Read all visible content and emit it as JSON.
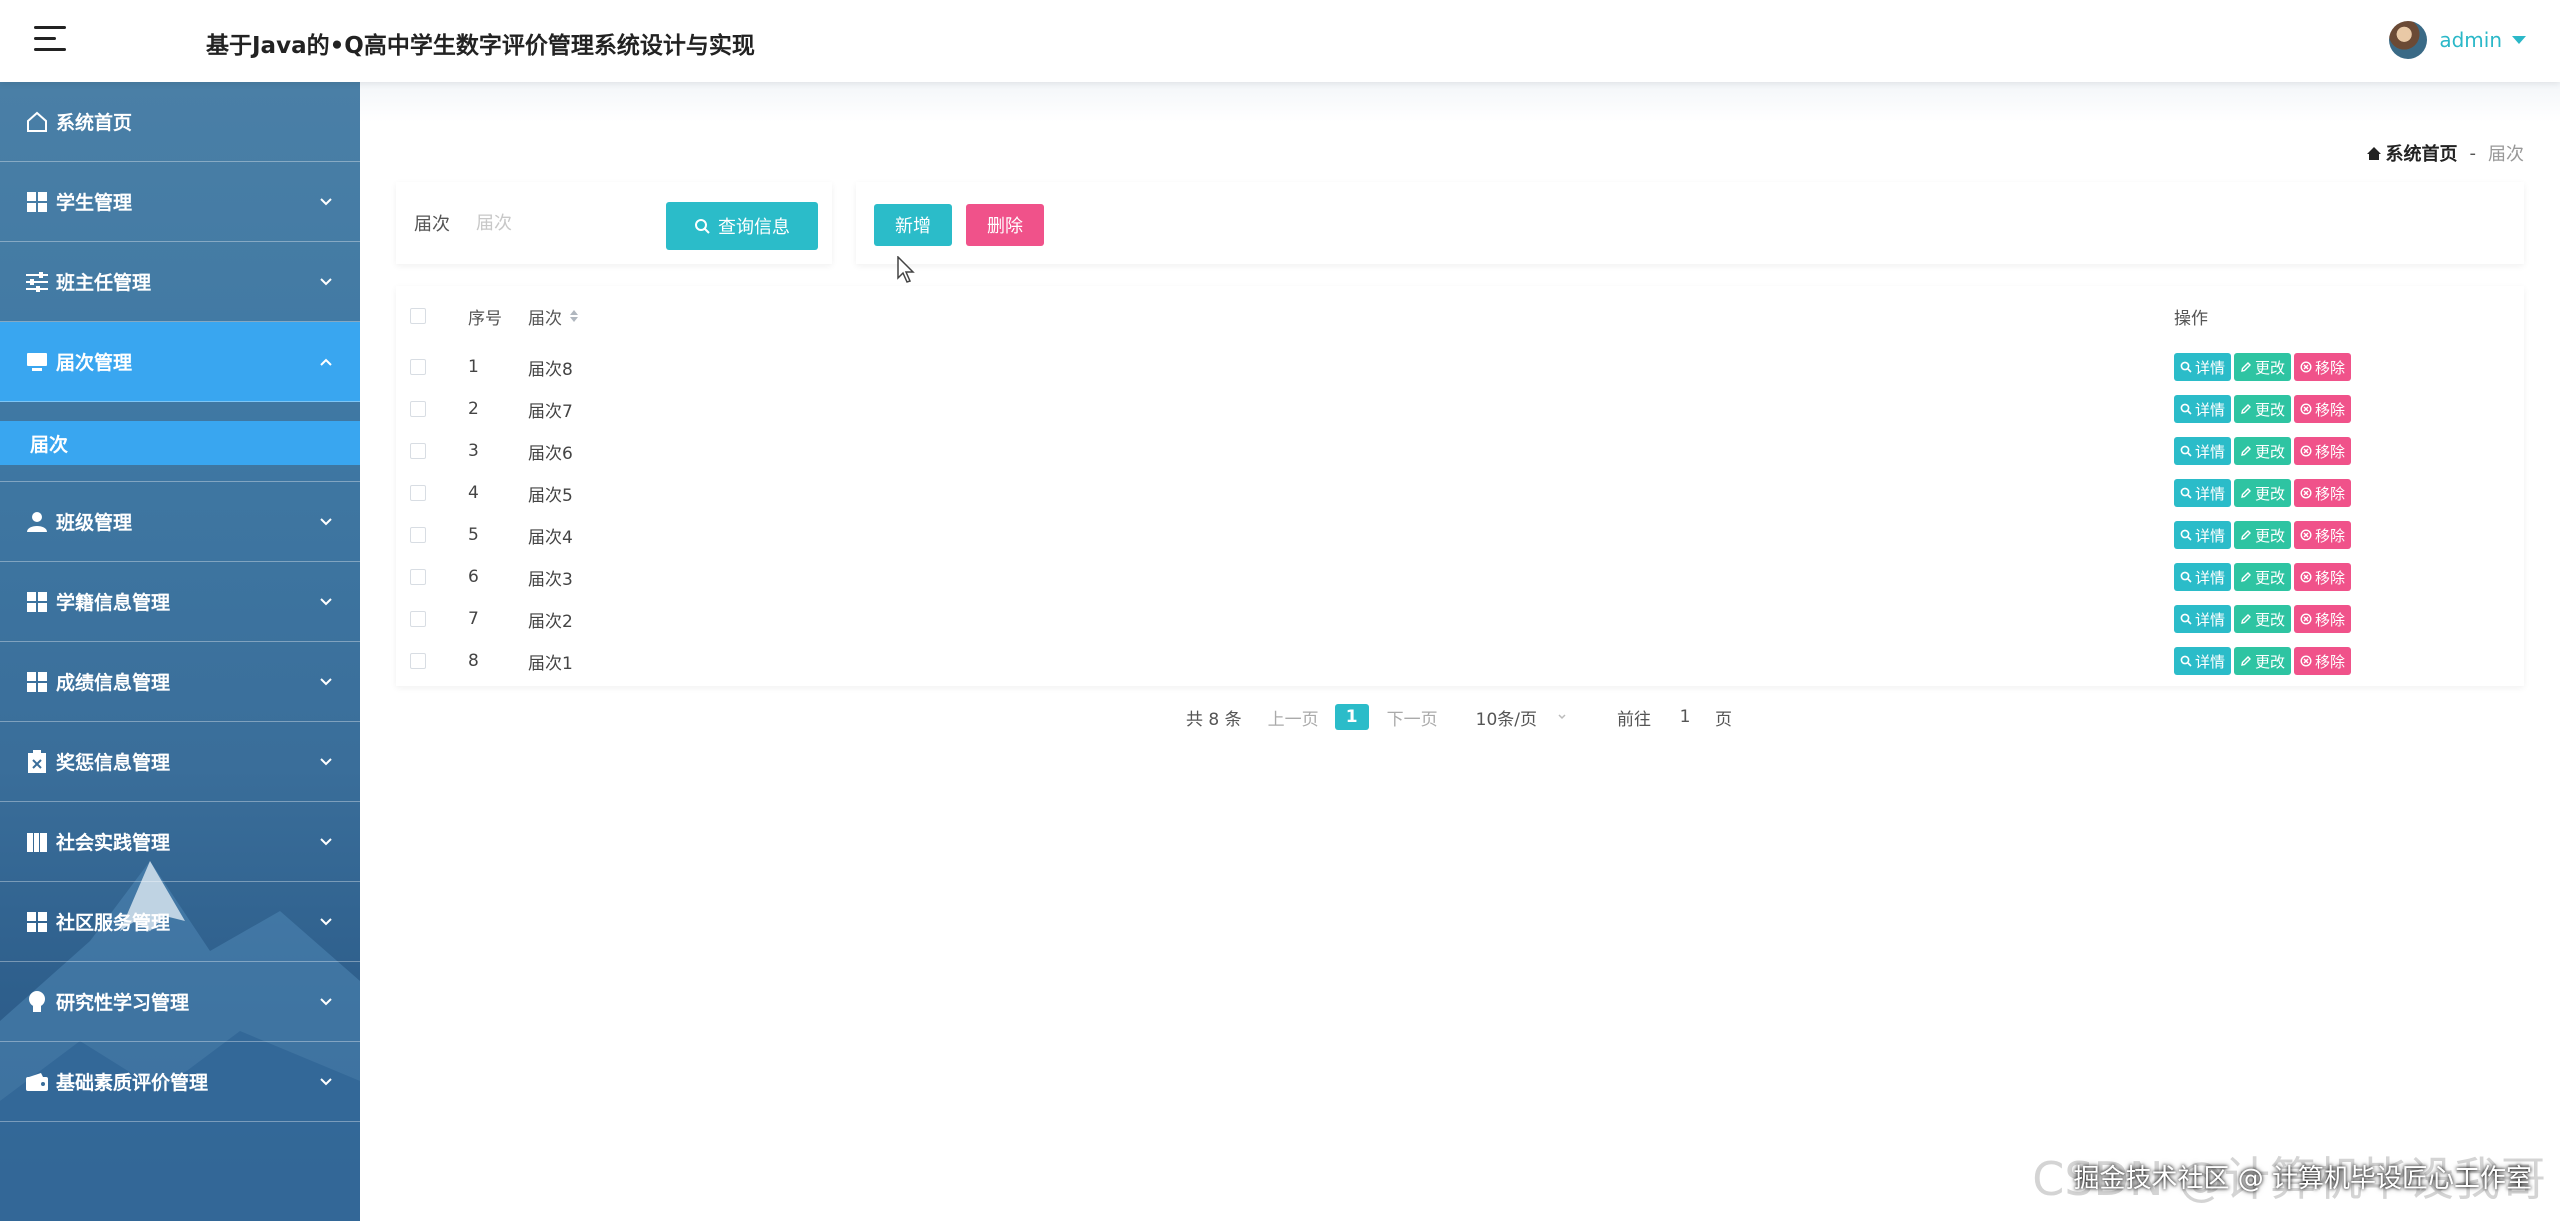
{
  "header": {
    "title": "基于Java的•Q高中学生数字评价管理系统设计与实现",
    "user_name": "admin"
  },
  "sidebar": {
    "items": [
      {
        "label": "系统首页",
        "icon": "home-icon"
      },
      {
        "label": "学生管理",
        "icon": "grid-icon"
      },
      {
        "label": "班主任管理",
        "icon": "sliders-icon"
      },
      {
        "label": "届次管理",
        "icon": "monitor-icon",
        "active": true
      },
      {
        "label": "班级管理",
        "icon": "user-icon"
      },
      {
        "label": "学籍信息管理",
        "icon": "grid-icon"
      },
      {
        "label": "成绩信息管理",
        "icon": "grid-icon"
      },
      {
        "label": "奖惩信息管理",
        "icon": "clipboard-icon"
      },
      {
        "label": "社会实践管理",
        "icon": "book-icon"
      },
      {
        "label": "社区服务管理",
        "icon": "grid-icon"
      },
      {
        "label": "研究性学习管理",
        "icon": "bulb-icon"
      },
      {
        "label": "基础素质评价管理",
        "icon": "wallet-icon"
      }
    ],
    "submenu": {
      "label": "届次"
    }
  },
  "breadcrumb": {
    "home": "系统首页",
    "separator": "-",
    "current": "届次"
  },
  "search": {
    "label": "届次",
    "placeholder": "届次",
    "button": "查询信息"
  },
  "actions": {
    "add": "新增",
    "delete": "删除"
  },
  "table": {
    "headers": {
      "index": "序号",
      "name": "届次",
      "ops": "操作"
    },
    "ops": {
      "detail": "详情",
      "edit": "更改",
      "remove": "移除"
    },
    "rows": [
      {
        "index": "1",
        "name": "届次8"
      },
      {
        "index": "2",
        "name": "届次7"
      },
      {
        "index": "3",
        "name": "届次6"
      },
      {
        "index": "4",
        "name": "届次5"
      },
      {
        "index": "5",
        "name": "届次4"
      },
      {
        "index": "6",
        "name": "届次3"
      },
      {
        "index": "7",
        "name": "届次2"
      },
      {
        "index": "8",
        "name": "届次1"
      }
    ]
  },
  "pagination": {
    "total": "共 8 条",
    "prev": "上一页",
    "current_page": "1",
    "next": "下一页",
    "page_size": "10条/页",
    "goto_label": "前往",
    "goto_value": "1",
    "goto_unit": "页"
  },
  "watermark": {
    "csdn": "CSDN @计算机毕设我哥",
    "juejin": "掘金技术社区 @ 计算机毕设匠心工作室"
  },
  "colors": {
    "accent": "#2bbcc9",
    "danger": "#f0528a",
    "edit": "#2ec4a2",
    "active_menu": "#39a6f0"
  }
}
